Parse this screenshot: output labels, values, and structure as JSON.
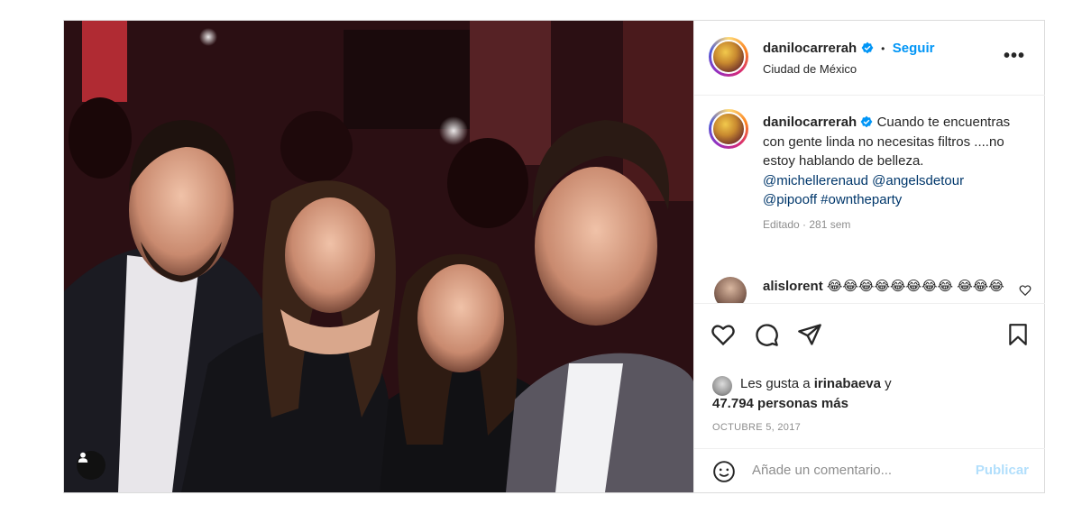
{
  "post": {
    "username": "danilocarrerah",
    "follow_label": "Seguir",
    "separator": "•",
    "location": "Ciudad de México",
    "more_label": "•••",
    "caption_text": "Cuando te encuentras con gente linda no necesitas filtros ....no estoy hablando de belleza.",
    "mentions": [
      "@michellerenaud",
      "@angelsdetour",
      "@pipooff"
    ],
    "hashtag": "#owntheparty",
    "edited": "Editado · 281 sem",
    "comment": {
      "username": "alislorent",
      "emojis": "😂😂😂😂😂😂😂😂 😂😂😂"
    },
    "likes": {
      "prefix": "Les gusta a",
      "liker": "irinabaeva",
      "connector": "y",
      "count": "47.794 personas más"
    },
    "date": "OCTUBRE 5, 2017",
    "add_comment_placeholder": "Añade un comentario...",
    "publish_label": "Publicar"
  },
  "colors": {
    "link_blue": "#0095f6",
    "publish_disabled": "#b2dffc",
    "mention": "#00376b",
    "muted": "#8e8e8e"
  },
  "icons": [
    "verified-badge-icon",
    "more-options-icon",
    "heart-icon",
    "comment-icon",
    "share-icon",
    "bookmark-icon",
    "emoji-icon",
    "user-tag-icon",
    "small-heart-icon"
  ]
}
